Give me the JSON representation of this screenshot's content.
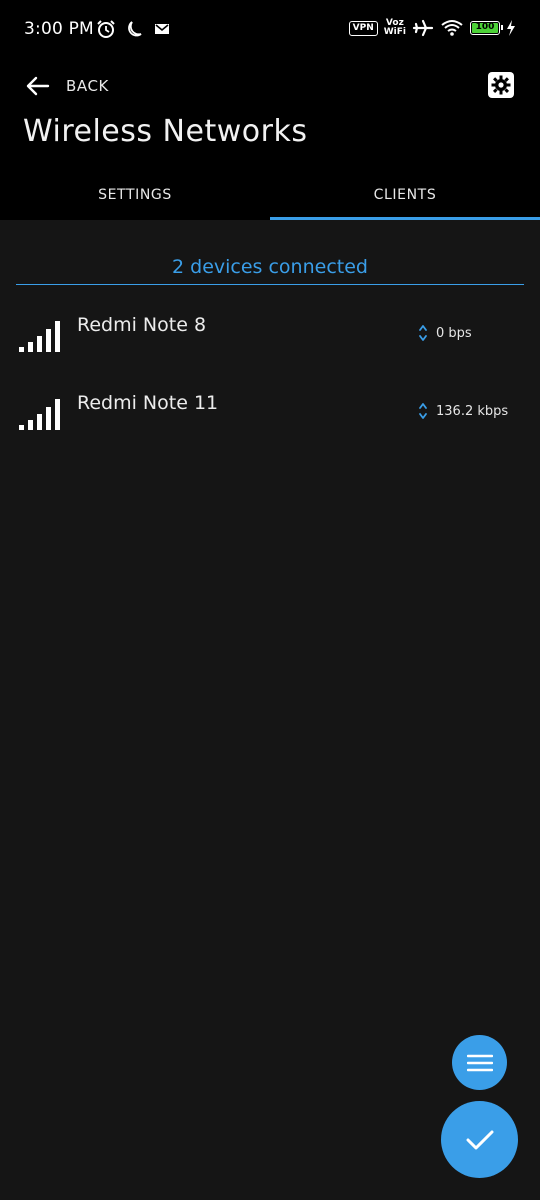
{
  "status_bar": {
    "time": "3:00 PM",
    "vpn_label": "VPN",
    "voz_label_top": "Voz",
    "voz_label_bottom": "WiFi",
    "battery_level": "100",
    "battery_color": "#4cd137"
  },
  "header": {
    "back_label": "BACK",
    "title": "Wireless Networks",
    "settings_icon": "gear-icon"
  },
  "tabs": [
    {
      "label": "SETTINGS",
      "active": false
    },
    {
      "label": "CLIENTS",
      "active": true
    }
  ],
  "clients": {
    "summary": "2 devices connected",
    "items": [
      {
        "name": "Redmi Note 8",
        "speed": "0 bps"
      },
      {
        "name": "Redmi Note 11",
        "speed": "136.2 kbps"
      }
    ]
  },
  "colors": {
    "accent": "#3a9ee8",
    "background": "#151515",
    "header_bg": "#000000"
  },
  "fabs": {
    "menu_icon": "menu-icon",
    "check_icon": "check-icon"
  }
}
